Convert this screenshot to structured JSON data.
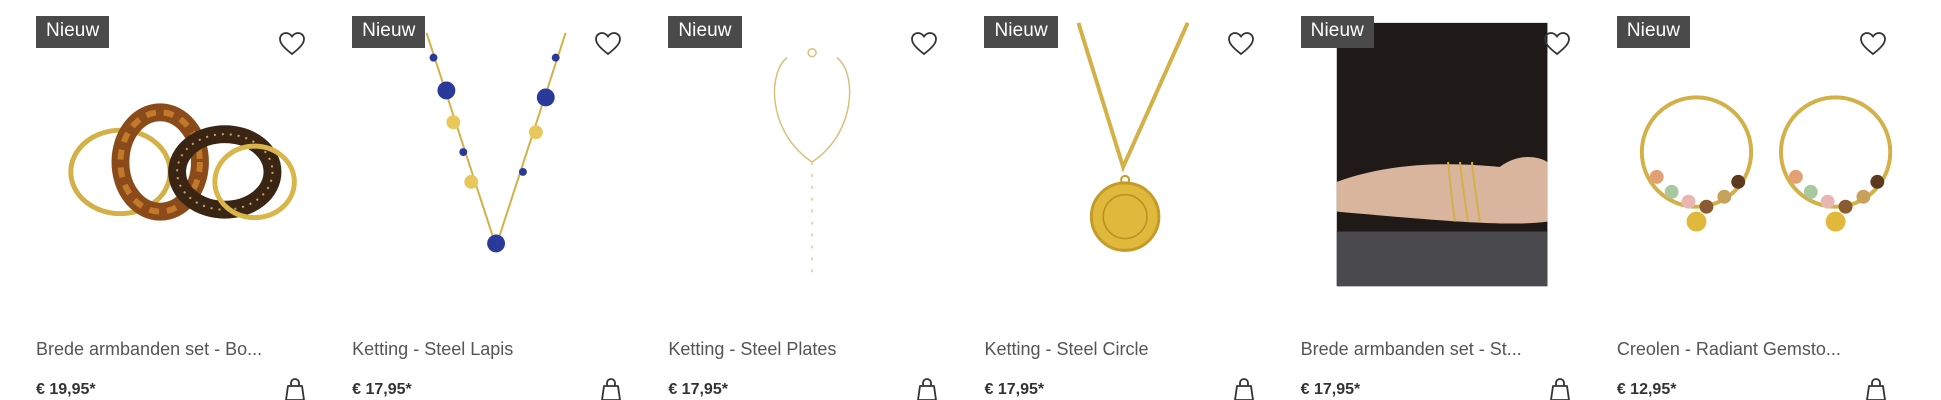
{
  "products": [
    {
      "badge": "Nieuw",
      "title": "Brede armbanden set - Bo...",
      "price": "€ 19,95*",
      "image_icon": "bangles-image"
    },
    {
      "badge": "Nieuw",
      "title": "Ketting - Steel Lapis",
      "price": "€ 17,95*",
      "image_icon": "necklace-lapis-image"
    },
    {
      "badge": "Nieuw",
      "title": "Ketting - Steel Plates",
      "price": "€ 17,95*",
      "image_icon": "necklace-plates-image"
    },
    {
      "badge": "Nieuw",
      "title": "Ketting - Steel Circle",
      "price": "€ 17,95*",
      "image_icon": "necklace-circle-image"
    },
    {
      "badge": "Nieuw",
      "title": "Brede armbanden set - St...",
      "price": "€ 17,95*",
      "image_icon": "bracelets-model-image"
    },
    {
      "badge": "Nieuw",
      "title": "Creolen - Radiant Gemsto...",
      "price": "€ 12,95*",
      "image_icon": "earrings-image"
    }
  ],
  "colors": {
    "badge_bg": "#4a4a4a",
    "gold": "#d9b24a",
    "text": "#555555"
  },
  "icons": {
    "favorite": "heart-icon",
    "add_to_cart": "shopping-bag-icon"
  }
}
